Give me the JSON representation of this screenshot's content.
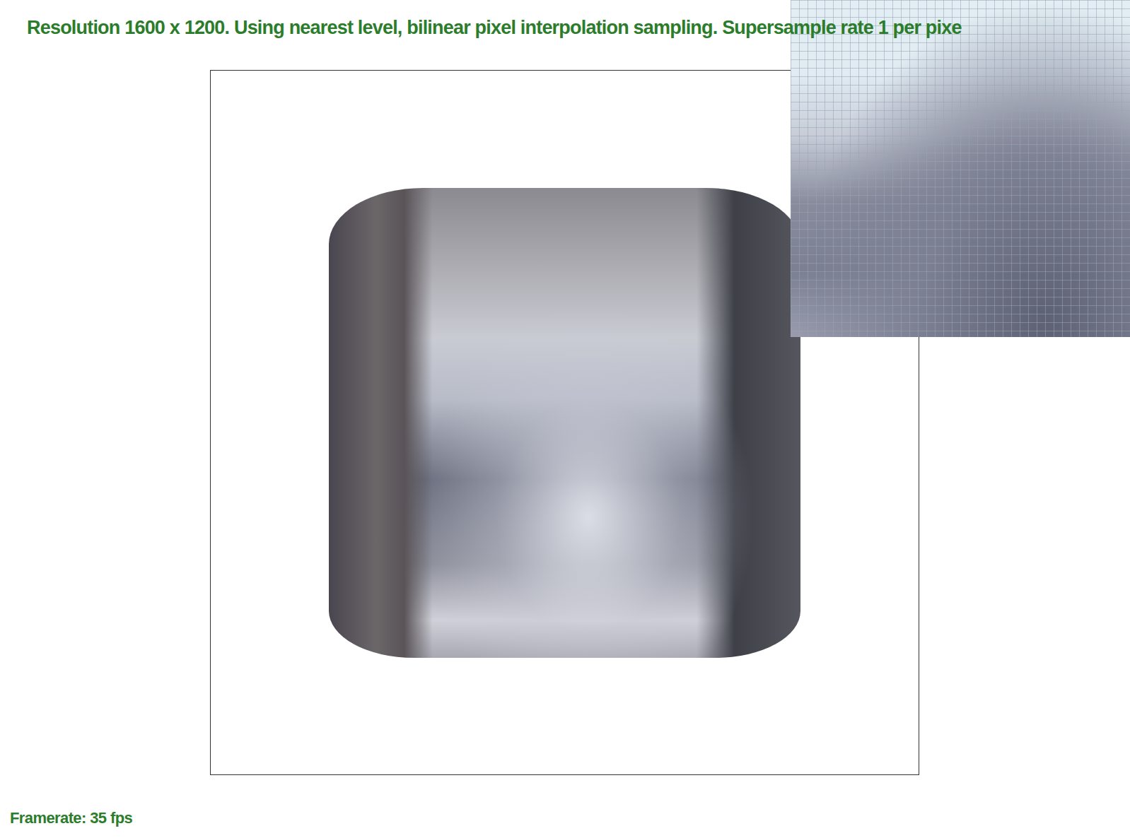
{
  "header": {
    "text": "Resolution 1600 x 1200. Using nearest level, bilinear pixel interpolation sampling. Supersample rate 1 per pixe"
  },
  "footer": {
    "framerate": "Framerate: 35 fps"
  }
}
